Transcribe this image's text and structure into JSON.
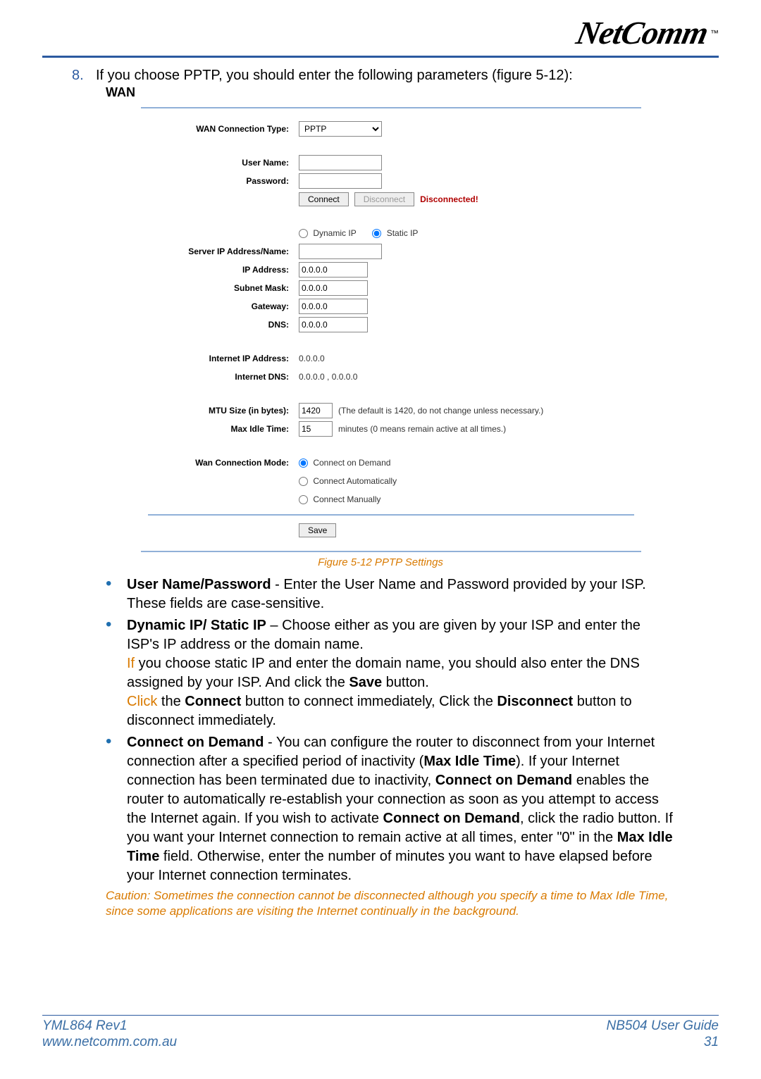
{
  "brand": {
    "name": "NetComm",
    "tm": "™"
  },
  "intro": {
    "num": "8.",
    "text": "If you choose PPTP, you should enter the following parameters (figure 5-12):"
  },
  "figure": {
    "section_title": "WAN",
    "labels": {
      "wan_conn_type": "WAN Connection Type:",
      "username": "User Name:",
      "password": "Password:",
      "server_ip": "Server IP Address/Name:",
      "ip_addr": "IP Address:",
      "subnet": "Subnet Mask:",
      "gateway": "Gateway:",
      "dns": "DNS:",
      "internet_ip": "Internet IP Address:",
      "internet_dns": "Internet DNS:",
      "mtu": "MTU Size (in bytes):",
      "max_idle": "Max Idle Time:",
      "wan_mode": "Wan Connection Mode:"
    },
    "values": {
      "wan_conn_type": "PPTP",
      "username": "",
      "password": "",
      "server_ip": "",
      "ip_addr": "0.0.0.0",
      "subnet": "0.0.0.0",
      "gateway": "0.0.0.0",
      "dns": "0.0.0.0",
      "internet_ip": "0.0.0.0",
      "internet_dns": "0.0.0.0 , 0.0.0.0",
      "mtu": "1420",
      "max_idle": "15"
    },
    "hints": {
      "mtu": "(The default is 1420, do not change unless necessary.)",
      "max_idle": "minutes (0 means remain active at all times.)"
    },
    "buttons": {
      "connect": "Connect",
      "disconnect": "Disconnect",
      "save": "Save"
    },
    "status": "Disconnected!",
    "radios": {
      "dynamic": "Dynamic IP",
      "static": "Static IP",
      "on_demand": "Connect on Demand",
      "auto": "Connect Automatically",
      "manual": "Connect Manually"
    },
    "caption": "Figure 5-12 PPTP Settings"
  },
  "bullets": {
    "b1_label": "User Name/Password",
    "b1_text": " - Enter the User Name and Password provided by your ISP. These fields are case-sensitive.",
    "b2_label": "Dynamic IP/ Static IP",
    "b2_text": " – Choose either as you are given by your ISP and enter the ISP's IP address or the domain name.",
    "b2_if": "If",
    "b2_if_rest": " you choose static IP and enter the domain name, you should also enter the DNS assigned by your ISP. And click the ",
    "b2_save": "Save",
    "b2_after_save": " button.",
    "b2_click": "Click",
    "b2_click_rest1": " the ",
    "b2_connect": "Connect",
    "b2_click_rest2": " button to connect immediately, Click the ",
    "b2_disconnect": "Disconnect",
    "b2_click_rest3": " button to disconnect immediately.",
    "b3_label": "Connect on Demand",
    "b3_t1": " - You can configure the router to disconnect from your Internet connection after a specified period of inactivity (",
    "b3_mit": "Max Idle Time",
    "b3_t2": "). If your Internet connection has been terminated due to inactivity, ",
    "b3_cod": "Connect on Demand",
    "b3_t3": " enables the router to automatically re-establish your connection as soon as you attempt to access the Internet again. If you wish to activate ",
    "b3_cod2": "Connect on Demand",
    "b3_t4": ", click the radio button. If you want your Internet connection to remain active at all times, enter \"0\" in the ",
    "b3_mit2": "Max Idle Time",
    "b3_t5": " field. Otherwise, enter the number of minutes you want to have elapsed before your Internet connection terminates."
  },
  "caution": "Caution: Sometimes the connection cannot be disconnected although you specify a time to Max Idle Time, since some applications are visiting the Internet continually in the background.",
  "footer": {
    "left1": "YML864 Rev1",
    "left2": "www.netcomm.com.au",
    "right1": "NB504 User Guide",
    "right2": "31"
  }
}
